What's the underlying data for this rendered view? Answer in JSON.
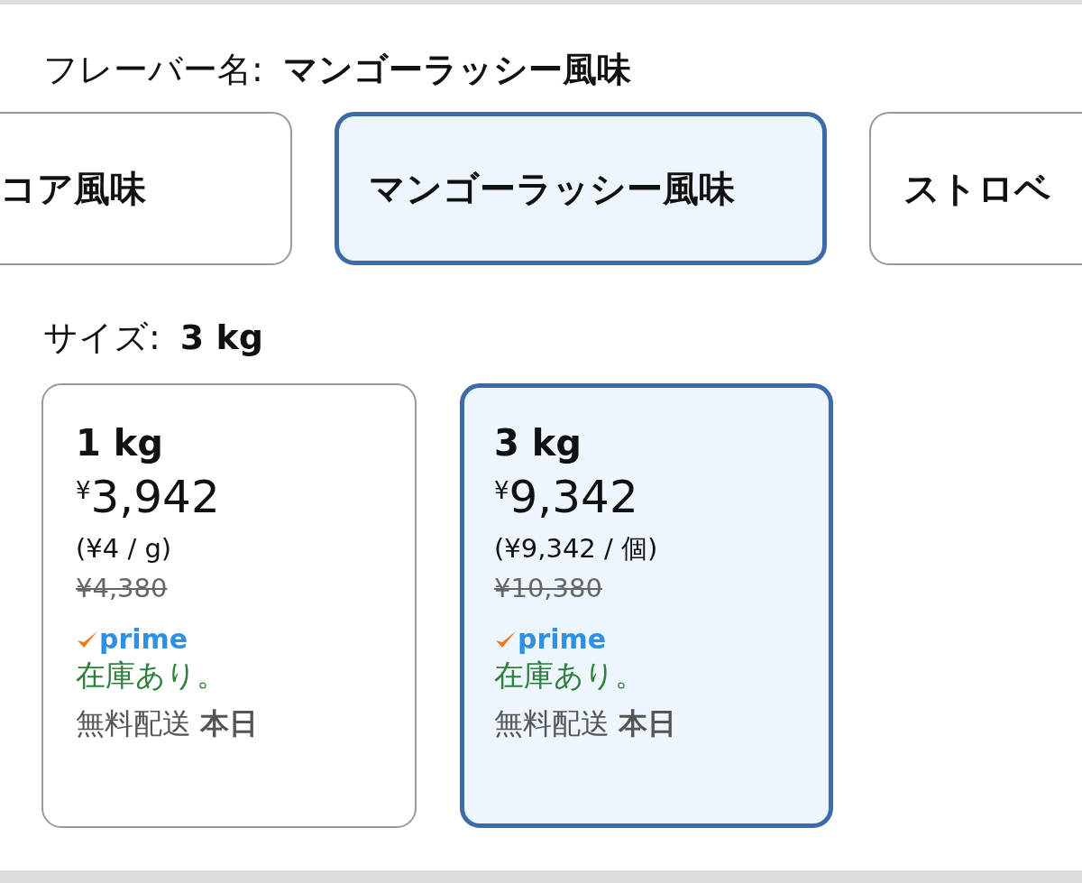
{
  "flavor": {
    "label": "フレーバー名:",
    "value": "マンゴーラッシー風味",
    "options": [
      {
        "label": "コア風味",
        "selected": false
      },
      {
        "label": "マンゴーラッシー風味",
        "selected": true
      },
      {
        "label": "ストロベ",
        "selected": false
      }
    ]
  },
  "size": {
    "label": "サイズ:",
    "value": "3 kg",
    "options": [
      {
        "name": "1 kg",
        "currency": "¥",
        "price": "3,942",
        "unit_price": "(¥4 / g)",
        "list_price": "¥4,380",
        "prime": "prime",
        "stock": "在庫あり。",
        "delivery": "無料配送 **本日**",
        "selected": false
      },
      {
        "name": "3 kg",
        "currency": "¥",
        "price": "9,342",
        "unit_price": "(¥9,342 / 個)",
        "list_price": "¥10,380",
        "prime": "prime",
        "stock": "在庫あり。",
        "delivery": "無料配送 **本日**",
        "selected": true
      }
    ]
  }
}
